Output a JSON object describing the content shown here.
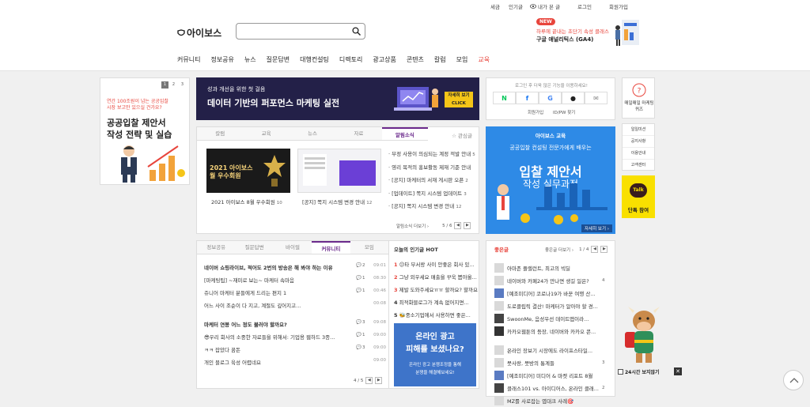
{
  "topbar": {
    "tax": "세금",
    "popular": "인기글",
    "myview": "내가 본 글",
    "login": "로그인",
    "signup": "회원가입"
  },
  "header": {
    "logo": "아이보스",
    "search": {
      "placeholder": ""
    },
    "ad": {
      "badge": "NEW",
      "line1": "하루에 끝내는 초단기 속성 클래스",
      "line2": "구글 애널리틱스 (GA4)"
    }
  },
  "nav": [
    "커뮤니티",
    "정보공유",
    "뉴스",
    "질문답변",
    "대행컨설팅",
    "디렉토리",
    "광고상품",
    "콘텐츠",
    "칼럼",
    "모임",
    "교육"
  ],
  "left_ad": {
    "pages": [
      "1",
      "2",
      "3"
    ],
    "line1": "연간 100조원이 넘는 공공입찰",
    "line2": "시장 보고만 있으실 건가요?",
    "title1": "공공입찰 제안서",
    "title2": "작성 전략 및 실습"
  },
  "banner_main": {
    "sub": "성과 개선을 위한 첫 걸음",
    "title": "데이터 기반의 퍼포먼스 마케팅 실전",
    "btn": "자세히 보기 CLICK"
  },
  "news_box": {
    "tabs": [
      "칼럼",
      "교육",
      "뉴스",
      "자료",
      "알림소식"
    ],
    "fav": "☆ 관심글",
    "cards": [
      {
        "img": "2021 아이보스 월 우수회원",
        "caption": "2021 아이보스 8월 우수회원",
        "count": "10"
      },
      {
        "caption": "[공지] 쪽지 시스템 변경 안내",
        "count": "12"
      }
    ],
    "items": [
      {
        "t": "부정 사용이 의심되는 계정 적발 안내",
        "c": "5"
      },
      {
        "t": "영리 목적의 홍보활동 제재 기준 안내",
        "c": ""
      },
      {
        "t": "[공지] 마케터의 서재 게시판 오픈",
        "c": "2"
      },
      {
        "t": "[업데이트] 쪽지 시스템 업데이트",
        "c": "3"
      },
      {
        "t": "[공지] 쪽지 시스템 변경 안내",
        "c": "12"
      }
    ],
    "more": "알림소식 더보기 ›",
    "page": "5 / 6"
  },
  "login_box": {
    "msg": "로그인 후 더욱 많은 기능을 이용하세요!",
    "signup": "회원가입",
    "find": "ID/PW 찾기"
  },
  "quiz": {
    "label": "매일매일 마케팅퀴즈",
    "side": [
      "일일미션",
      "공지사항",
      "이용안내",
      "고객센터"
    ],
    "talk": "Talk",
    "talk_label": "단톡 참여"
  },
  "edu_ad": {
    "brand": "아이보스 교육",
    "line1": "공공입찰 컨설팅 전문가에게 배우는",
    "title1": "입찰 제안서",
    "title2": "작성 실무과정",
    "btn": "자세히 보기 ›"
  },
  "community": {
    "tabs": [
      "정보공유",
      "질문답변",
      "바이럴",
      "커뮤니티",
      "모임"
    ],
    "items": [
      {
        "t": "네이버 쇼핑라이브, 적어도 2번의 방송은 해 봐야 하는 이유",
        "c": "2",
        "time": "09:01",
        "bold": true
      },
      {
        "t": "[마케팅팁] ~재미로 보는~ 마케터 속마음",
        "c": "1",
        "time": "08:30"
      },
      {
        "t": "쥬니어 마케터 분들에게 드리는 편지 1",
        "c": "1",
        "time": "00:46"
      },
      {
        "t": "어느 사이 조순이 다 지고, 계절도 깊어지고...",
        "c": "",
        "time": "00:08"
      },
      {
        "t": "마케터 연봉 어느 정도 불러야 할까요?",
        "c": "3",
        "time": "09:08",
        "bold": true
      },
      {
        "t": "😎우리 회사의 소중한 자료들을 위해서: 기업용 웹하드 3종...",
        "c": "1",
        "time": "09:00"
      },
      {
        "t": "ㅋㅋ 잡았다 꿈돈",
        "c": "3",
        "time": "09:00"
      },
      {
        "t": "개인 블로그 육성 어렵네요",
        "c": "",
        "time": "09:00"
      }
    ],
    "page": "4 / 5"
  },
  "hot": {
    "title": "오늘의 인기글 HOT",
    "items": [
      {
        "n": "1",
        "t": "😕타 부서랑 사이 안좋은 회사 있..."
      },
      {
        "n": "2",
        "t": "그냥 외우세요 매출을 꾸욱 뽑아올..."
      },
      {
        "n": "3",
        "t": "제발 도와주세요ㅠㅠ 할까요? 할까요?"
      },
      {
        "n": "4",
        "t": "최적화블로그가 계속 없어지면..."
      },
      {
        "n": "5",
        "t": "🐝중소기업에서 사용하면 좋은..."
      }
    ],
    "ad1": "온라인 광고",
    "ad2": "피해를 보셨나요?",
    "ad3": "온라인 광고 분쟁조정을 통해",
    "ad4": "분쟁을 해결해보세요!"
  },
  "good": {
    "title": "좋은글",
    "more": "좋은글 더보기 ›",
    "page": "1 / 4",
    "items": [
      {
        "t": "아마존 플렐런트, 최고의 빅딜",
        "c": ""
      },
      {
        "t": "네이버와 카페24가 만나면 생길 일은?",
        "c": "4"
      },
      {
        "t": "[예조미디어] 코로나19가 바꾼 여행 산...",
        "c": ""
      },
      {
        "t": "도로클립릭 결산! 마케터가 알아야 할 경...",
        "c": ""
      },
      {
        "t": "SwoonMe, 음성우선 데이트앱이라...",
        "c": ""
      },
      {
        "t": "카카오웹툰의 등장, 네이버와 카카오 콘...",
        "c": ""
      }
    ],
    "items2": [
      {
        "t": "온라인 장보기 시장에도 라이프스타일...",
        "c": ""
      },
      {
        "t": "뭇사랑, 뭇방의 통계들",
        "c": "3"
      },
      {
        "t": "[예조미디어] 미디어 & 마켓 리포트 8월",
        "c": ""
      },
      {
        "t": "클래스101 vs. 아이디어스, 온라인 클래...",
        "c": "2"
      },
      {
        "t": "MZ를 사로잡는 엽대크 사례🎯",
        "c": ""
      }
    ]
  },
  "floating": {
    "label": "24시간 보지않기"
  }
}
